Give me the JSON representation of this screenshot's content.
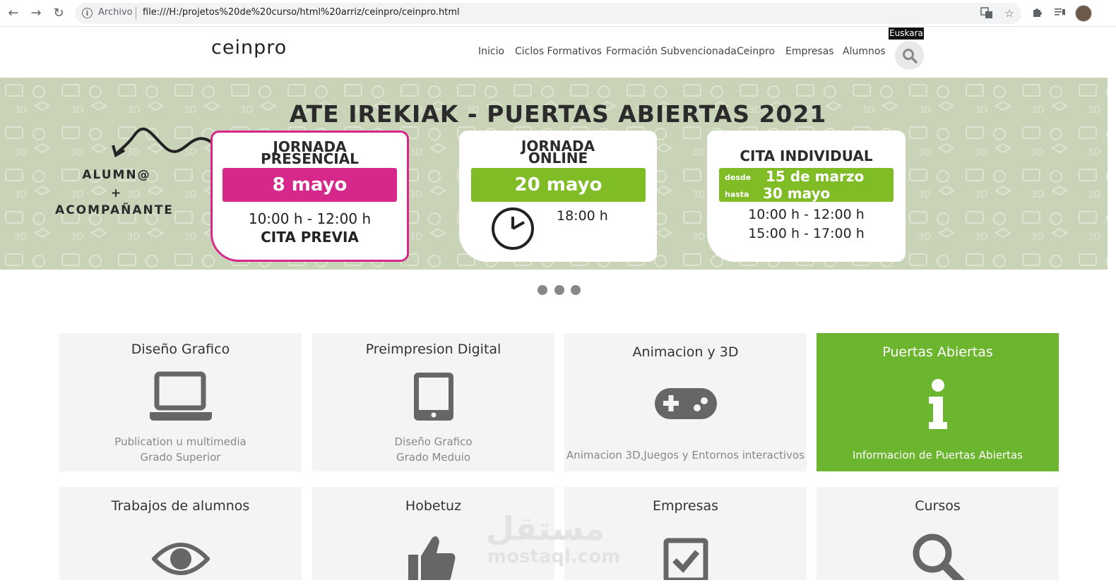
{
  "browser": {
    "back_icon": "arrow-left-icon",
    "forward_icon": "arrow-right-icon",
    "reload_icon": "reload-icon",
    "scheme": "Archivo",
    "url": "file:///H:/projetos%20de%20curso/html%20arriz/ceinpro/ceinpro.html"
  },
  "site": {
    "logo": "ceinpro",
    "language": "Euskara",
    "nav": [
      "Inicio",
      "Ciclos Formativos",
      "Formación Subvencionada",
      "Ceinpro",
      "Empresas",
      "Alumnos"
    ]
  },
  "banner": {
    "title": "ATE IREKIAK - PUERTAS ABIERTAS 2021",
    "side_line1": "ALUMN@",
    "side_line2": "+",
    "side_line3": "ACOMPAÑANTE",
    "card1": {
      "title1": "JORNADA",
      "title2": "PRESENCIAL",
      "date": "8 mayo",
      "time": "10:00 h - 12:00 h",
      "note": "CITA PREVIA"
    },
    "card2": {
      "title1": "JORNADA",
      "title2": "ONLINE",
      "date": "20 mayo",
      "time": "18:00 h"
    },
    "card3": {
      "title": "CITA INDIVIDUAL",
      "from_label": "desde",
      "from_date": "15 de marzo",
      "to_label": "hasta",
      "to_date": "30 mayo",
      "time1": "10:00 h - 12:00 h",
      "time2": "15:00 h - 17:00 h"
    },
    "colors": {
      "bg": "#c9d3b8",
      "magenta": "#d6288a",
      "green": "#7fbc25"
    }
  },
  "slider": {
    "dots": 3
  },
  "tiles_row1": [
    {
      "title": "Diseño Grafico",
      "icon": "laptop-icon",
      "desc1": "Publication u multimedia",
      "desc2": "Grado Superior"
    },
    {
      "title": "Preimpresion Digital",
      "icon": "tablet-icon",
      "desc1": "Diseño Grafico",
      "desc2": "Grado Meduio"
    },
    {
      "title": "Animacion y 3D",
      "icon": "gamepad-icon",
      "desc1": "Animacion 3D,Juegos y Entornos interactivos",
      "desc2": ""
    },
    {
      "title": "Puertas Abiertas",
      "icon": "info-icon",
      "desc1": "Informacion de Puertas Abiertas",
      "desc2": ""
    }
  ],
  "tiles_row2": [
    {
      "title": "Trabajos de alumnos",
      "icon": "eye-icon"
    },
    {
      "title": "Hobetuz",
      "icon": "thumbs-up-icon"
    },
    {
      "title": "Empresas",
      "icon": "checkbox-icon"
    },
    {
      "title": "Cursos",
      "icon": "search-icon"
    }
  ],
  "watermark": {
    "arabic": "مستقل",
    "latin": "mostaql.com"
  },
  "accent_green": "#6cb52e"
}
